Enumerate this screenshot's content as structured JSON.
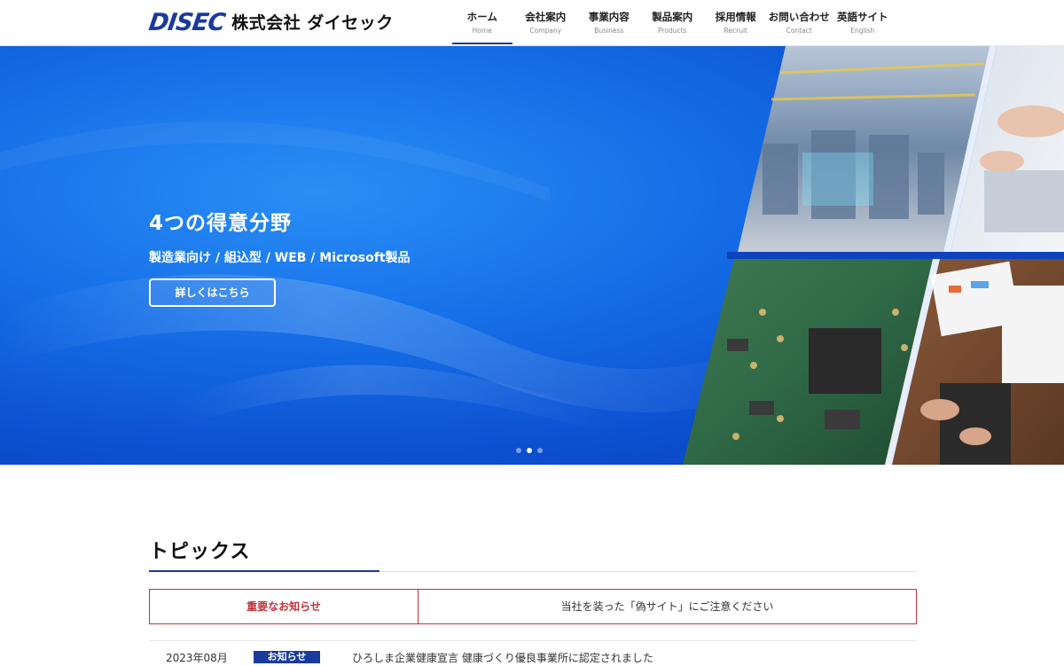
{
  "header": {
    "logo_mark": "DISEC",
    "logo_name": "株式会社 ダイセック",
    "nav": [
      {
        "jp": "ホーム",
        "en": "Home"
      },
      {
        "jp": "会社案内",
        "en": "Company"
      },
      {
        "jp": "事業内容",
        "en": "Business"
      },
      {
        "jp": "製品案内",
        "en": "Products"
      },
      {
        "jp": "採用情報",
        "en": "Recruit"
      },
      {
        "jp": "お問い合わせ",
        "en": "Contact"
      },
      {
        "jp": "英語サイト",
        "en": "English"
      }
    ],
    "active_index": 0
  },
  "hero": {
    "title": "4つの得意分野",
    "subtitle": "製造業向け / 組込型 / WEB / Microsoft製品",
    "button_label": "詳しくはこちら",
    "slides_total": 3,
    "active_slide": 2
  },
  "topics": {
    "title": "トピックス",
    "notice_label": "重要なお知らせ",
    "notice_text": "当社を装った「偽サイト」にご注意ください",
    "news": [
      {
        "date": "2023年08月",
        "badge": "お知らせ",
        "text": "ひろしま企業健康宣言 健康づくり優良事業所に認定されました"
      }
    ]
  },
  "colors": {
    "brand": "#1a3a9c",
    "notice": "#c0313a",
    "hero_blue": "#1670e8"
  }
}
